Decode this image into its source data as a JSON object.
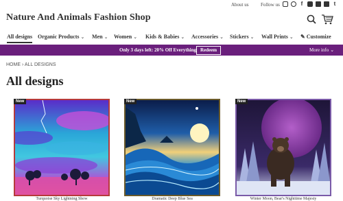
{
  "topbar": {
    "about": "About us",
    "follow": "Follow us",
    "social_icons": [
      "instagram-icon",
      "pinterest-icon",
      "facebook-icon",
      "youtube-icon",
      "tiktok-icon",
      "square-icon",
      "twitter-icon"
    ]
  },
  "header": {
    "logo": "Nature And Animals Fashion Shop"
  },
  "nav": {
    "items": [
      {
        "label": "All designs"
      },
      {
        "label": "Organic Products"
      },
      {
        "label": "Men"
      },
      {
        "label": "Women"
      },
      {
        "label": "Kids & Babies"
      },
      {
        "label": "Accessories"
      },
      {
        "label": "Stickers"
      },
      {
        "label": "Wall Prints"
      },
      {
        "label": "Customize"
      }
    ]
  },
  "promo": {
    "text": "Only 3 days left:  20% Off Everything",
    "button": "Redeem",
    "more": "More info"
  },
  "breadcrumb": {
    "home": "HOME",
    "current": "ALL DESIGNS"
  },
  "page_title": "All designs",
  "products": [
    {
      "badge": "New",
      "caption": "Turquoise Sky Lightning Show"
    },
    {
      "badge": "New",
      "caption": "Dramatic Deep Blue Sea"
    },
    {
      "badge": "New",
      "caption": "Winter Moon, Bear's Nighttime Majesty"
    }
  ],
  "colors": {
    "promo_bg": "#6a1f7c",
    "frame_1": "#b63a3a",
    "frame_2": "#6b5a2a",
    "frame_3": "#7a5aa8"
  }
}
